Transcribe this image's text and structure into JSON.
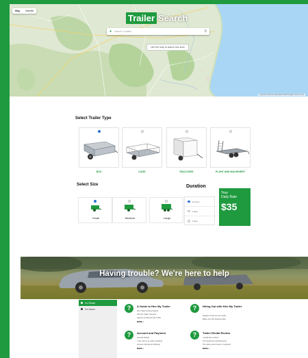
{
  "map": {
    "view_tabs": [
      "Map",
      "Satellite"
    ],
    "brand_part1": "Trailer",
    "brand_part2": "Search",
    "search_placeholder": "Search Location",
    "map_button": "Use the map to search this area",
    "attribution": "Keyboard shortcuts   Map data ©2023 Google   Terms of Use"
  },
  "trailer_type": {
    "title": "Select Trailer Type",
    "options": [
      {
        "label": "BOX",
        "selected": true
      },
      {
        "label": "CAGE",
        "selected": false
      },
      {
        "label": "ENCLOSED",
        "selected": false
      },
      {
        "label": "PLANT AND MACHINERY",
        "selected": false
      }
    ]
  },
  "size": {
    "title": "Select Size",
    "options": [
      {
        "label": "Small",
        "selected": true
      },
      {
        "label": "Medium",
        "selected": false
      },
      {
        "label": "Large",
        "selected": false
      }
    ]
  },
  "duration": {
    "title": "Duration",
    "options": [
      {
        "label": "24 hours",
        "selected": true
      },
      {
        "label": "2 days",
        "selected": false
      },
      {
        "label": "3 days",
        "selected": false
      }
    ]
  },
  "rate": {
    "line1": "Your",
    "line2": "Daily Rate",
    "amount": "$35"
  },
  "banner": {
    "message": "Having trouble? We're here to help"
  },
  "help": {
    "nav": [
      {
        "label": "For Renter",
        "active": true
      },
      {
        "label": "For Owner",
        "active": false
      }
    ],
    "topics": [
      {
        "title": "A Guide to Hire My Trailer",
        "lines": [
          "Hire Trailer Getting Started",
          "Hire My Trailer Overview",
          "Signing up with Hire My Trailer"
        ],
        "more": "MORE >"
      },
      {
        "title": "Hiring Out with Hire My Trailer",
        "lines": [
          "Register & find out your trailer",
          "Make your first booking today"
        ],
        "more": ""
      },
      {
        "title": "Account and Payment",
        "lines": [
          "General Details",
          "I can't sign in to make a booking",
          "Account Settings and Ratings"
        ],
        "more": "MORE >"
      },
      {
        "title": "Trailer Rental Review",
        "lines": [
          "I would like a refund",
          "The rental was unprofessional",
          "The trailer wasn't clean or expected"
        ],
        "more": "MORE >"
      }
    ]
  },
  "colors": {
    "brand": "#1f9a3f",
    "selected_radio": "#2a6fd6"
  },
  "icons": [
    "map-pin-icon",
    "search-icon",
    "question-icon",
    "trailer-icon"
  ]
}
